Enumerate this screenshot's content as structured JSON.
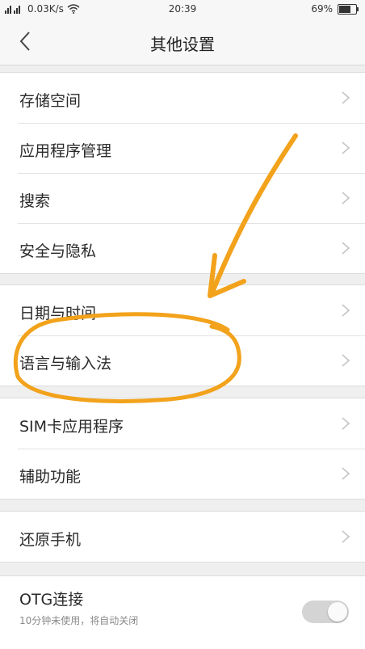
{
  "status_bar": {
    "net_speed": "0.03K/s",
    "time": "20:39",
    "battery": "69%",
    "battery_level": 0.69
  },
  "header": {
    "title": "其他设置"
  },
  "groups": [
    {
      "items": [
        {
          "label": "存储空间"
        },
        {
          "label": "应用程序管理"
        },
        {
          "label": "搜索"
        },
        {
          "label": "安全与隐私"
        }
      ]
    },
    {
      "items": [
        {
          "label": "日期与时间"
        },
        {
          "label": "语言与输入法"
        }
      ]
    },
    {
      "items": [
        {
          "label": "SIM卡应用程序"
        },
        {
          "label": "辅助功能"
        }
      ]
    },
    {
      "items": [
        {
          "label": "还原手机"
        }
      ]
    }
  ],
  "otg": {
    "label": "OTG连接",
    "subtitle": "10分钟未使用，将自动关闭",
    "enabled": false
  },
  "colors": {
    "annotation": "#f2a21b",
    "background": "#efefef",
    "row_background": "#ffffff"
  }
}
